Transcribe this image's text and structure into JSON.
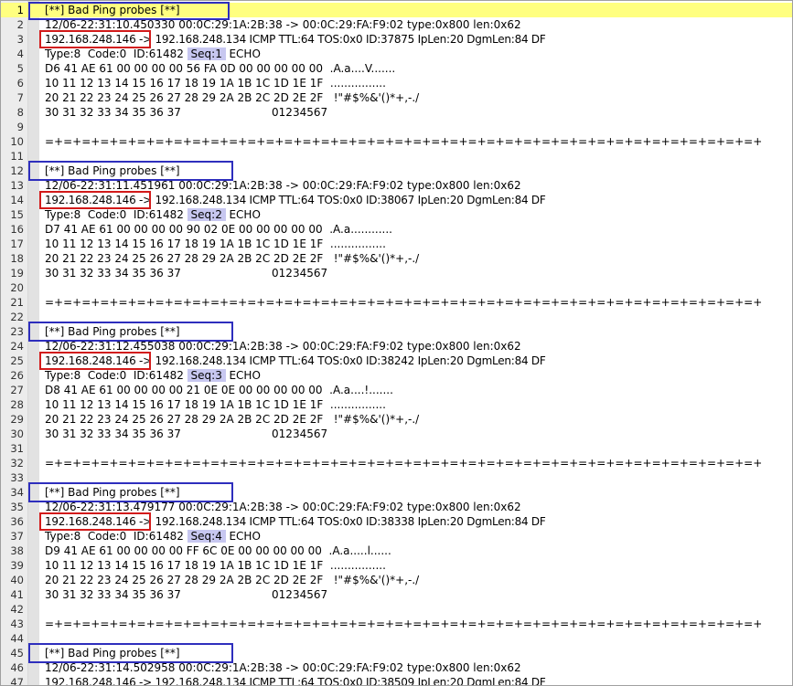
{
  "editor": {
    "current_line": 1,
    "lines": [
      "[**] Bad Ping probes [**]",
      "12/06-22:31:10.450330 00:0C:29:1A:2B:38 -> 00:0C:29:FA:F9:02 type:0x800 len:0x62",
      "192.168.248.146 -> 192.168.248.134 ICMP TTL:64 TOS:0x0 ID:37875 IpLen:20 DgmLen:84 DF",
      "Type:8  Code:0  ID:61482  Seq:1  ECHO",
      "D6 41 AE 61 00 00 00 00 56 FA 0D 00 00 00 00 00  .A.a....V.......",
      "10 11 12 13 14 15 16 17 18 19 1A 1B 1C 1D 1E 1F  ................",
      "20 21 22 23 24 25 26 27 28 29 2A 2B 2C 2D 2E 2F   !\"#$%&'()*+,-./",
      "30 31 32 33 34 35 36 37                          01234567",
      "",
      "=+=+=+=+=+=+=+=+=+=+=+=+=+=+=+=+=+=+=+=+=+=+=+=+=+=+=+=+=+=+=+=+=+=+=+=+=+=+=+",
      "",
      "[**] Bad Ping probes [**]",
      "12/06-22:31:11.451961 00:0C:29:1A:2B:38 -> 00:0C:29:FA:F9:02 type:0x800 len:0x62",
      "192.168.248.146 -> 192.168.248.134 ICMP TTL:64 TOS:0x0 ID:38067 IpLen:20 DgmLen:84 DF",
      "Type:8  Code:0  ID:61482  Seq:2  ECHO",
      "D7 41 AE 61 00 00 00 00 90 02 0E 00 00 00 00 00  .A.a............",
      "10 11 12 13 14 15 16 17 18 19 1A 1B 1C 1D 1E 1F  ................",
      "20 21 22 23 24 25 26 27 28 29 2A 2B 2C 2D 2E 2F   !\"#$%&'()*+,-./",
      "30 31 32 33 34 35 36 37                          01234567",
      "",
      "=+=+=+=+=+=+=+=+=+=+=+=+=+=+=+=+=+=+=+=+=+=+=+=+=+=+=+=+=+=+=+=+=+=+=+=+=+=+=+",
      "",
      "[**] Bad Ping probes [**]",
      "12/06-22:31:12.455038 00:0C:29:1A:2B:38 -> 00:0C:29:FA:F9:02 type:0x800 len:0x62",
      "192.168.248.146 -> 192.168.248.134 ICMP TTL:64 TOS:0x0 ID:38242 IpLen:20 DgmLen:84 DF",
      "Type:8  Code:0  ID:61482  Seq:3  ECHO",
      "D8 41 AE 61 00 00 00 00 21 0E 0E 00 00 00 00 00  .A.a....!.......",
      "10 11 12 13 14 15 16 17 18 19 1A 1B 1C 1D 1E 1F  ................",
      "20 21 22 23 24 25 26 27 28 29 2A 2B 2C 2D 2E 2F   !\"#$%&'()*+,-./",
      "30 31 32 33 34 35 36 37                          01234567",
      "",
      "=+=+=+=+=+=+=+=+=+=+=+=+=+=+=+=+=+=+=+=+=+=+=+=+=+=+=+=+=+=+=+=+=+=+=+=+=+=+=+",
      "",
      "[**] Bad Ping probes [**]",
      "12/06-22:31:13.479177 00:0C:29:1A:2B:38 -> 00:0C:29:FA:F9:02 type:0x800 len:0x62",
      "192.168.248.146 -> 192.168.248.134 ICMP TTL:64 TOS:0x0 ID:38338 IpLen:20 DgmLen:84 DF",
      "Type:8  Code:0  ID:61482  Seq:4  ECHO",
      "D9 41 AE 61 00 00 00 00 FF 6C 0E 00 00 00 00 00  .A.a.....l......",
      "10 11 12 13 14 15 16 17 18 19 1A 1B 1C 1D 1E 1F  ................",
      "20 21 22 23 24 25 26 27 28 29 2A 2B 2C 2D 2E 2F   !\"#$%&'()*+,-./",
      "30 31 32 33 34 35 36 37                          01234567",
      "",
      "=+=+=+=+=+=+=+=+=+=+=+=+=+=+=+=+=+=+=+=+=+=+=+=+=+=+=+=+=+=+=+=+=+=+=+=+=+=+=+",
      "",
      "[**] Bad Ping probes [**]",
      "12/06-22:31:14.502958 00:0C:29:1A:2B:38 -> 00:0C:29:FA:F9:02 type:0x800 len:0x62",
      "192.168.248.146 -> 192.168.248.134 ICMP TTL:64 TOS:0x0 ID:38509 IpLen:20 DgmLen:84 DF"
    ]
  },
  "annotations": {
    "blue_boxes_on_lines": [
      1,
      12,
      23,
      34,
      45
    ],
    "red_boxes_on_lines": [
      3,
      14,
      25,
      36
    ],
    "seq_highlight_on_lines": [
      4,
      15,
      26,
      37
    ]
  },
  "colors": {
    "current_line_highlight": "#ffff80",
    "blue_box": "#2e2ebd",
    "red_box": "#d21a1a",
    "seq_highlight": "#c7c7f0",
    "gutter": "#ececec"
  }
}
